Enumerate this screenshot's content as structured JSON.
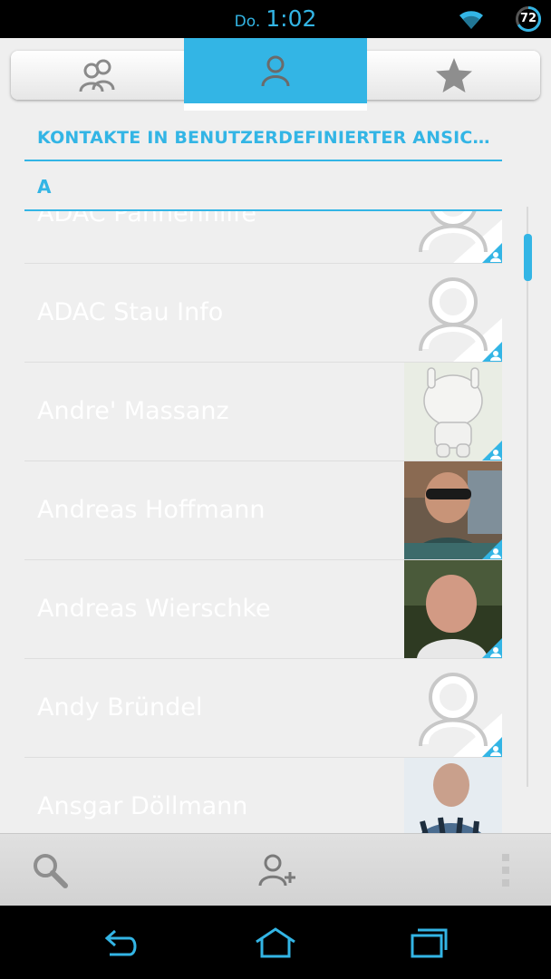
{
  "status_bar": {
    "day": "Do.",
    "time": "1:02",
    "battery_level": "72"
  },
  "tabs": [
    {
      "name": "groups",
      "icon": "contacts-group-icon",
      "active": false
    },
    {
      "name": "contacts",
      "icon": "person-icon",
      "active": true
    },
    {
      "name": "favorites",
      "icon": "star-icon",
      "active": false
    }
  ],
  "header": {
    "title": "KONTAKTE IN BENUTZERDEFINIERTER ANSIC…",
    "section_letter": "A"
  },
  "contacts": [
    {
      "name": "ADAC Pannenhilfe",
      "avatar": "placeholder"
    },
    {
      "name": "ADAC Stau Info",
      "avatar": "placeholder"
    },
    {
      "name": "Andre' Massanz",
      "avatar": "mascot-photo"
    },
    {
      "name": "Andreas Hoffmann",
      "avatar": "photo"
    },
    {
      "name": "Andreas Wierschke",
      "avatar": "photo"
    },
    {
      "name": "Andy Bründel",
      "avatar": "placeholder"
    },
    {
      "name": "Ansgar Döllmann",
      "avatar": "photo"
    }
  ],
  "action_bar": {
    "search_icon": "search-icon",
    "add_contact_icon": "add-contact-icon",
    "overflow_icon": "overflow-menu-icon"
  },
  "colors": {
    "accent": "#33b5e5",
    "background": "#efefef",
    "contact_text": "#ffffff"
  }
}
